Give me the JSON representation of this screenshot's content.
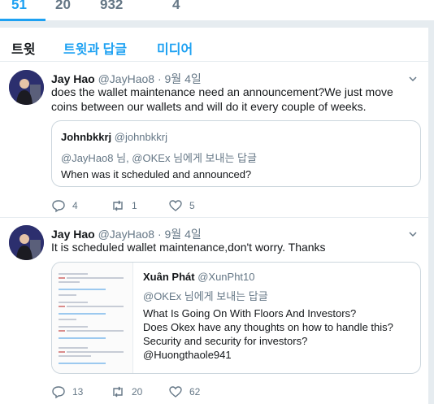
{
  "stats": [
    "51",
    "20",
    "932",
    "4"
  ],
  "tabs": [
    "트윗",
    "트윗과 답글",
    "미디어"
  ],
  "tweets": [
    {
      "name": "Jay Hao",
      "handle": "@JayHao8",
      "dot": "·",
      "date": "9월 4일",
      "text": "does the wallet maintenance need an announcement?We just move coins between our wallets and will do it every couple of weeks.",
      "quote": {
        "name": "Johnbkkrj",
        "handle": "@johnbkkrj",
        "reply_to": "@JayHao8 님, @OKEx 님에게 보내는 답글",
        "text": "When was it scheduled and announced?"
      },
      "replies": "4",
      "retweets": "1",
      "likes": "5"
    },
    {
      "name": "Jay Hao",
      "handle": "@JayHao8",
      "dot": "·",
      "date": "9월 4일",
      "text": "It is scheduled wallet maintenance,don't worry. Thanks",
      "quote": {
        "name": "Xuân Phát",
        "handle": "@XunPht10",
        "reply_to": "@OKEx 님에게 보내는 답글",
        "text_lines": [
          "What Is Going On With Floors And Investors?",
          "Does Okex have any thoughts on how to handle this?",
          "Security and security for investors?",
          "@Huongthaole941"
        ]
      },
      "replies": "13",
      "retweets": "20",
      "likes": "62"
    }
  ],
  "colors": {
    "accent": "#1da1f2",
    "muted": "#657786",
    "border": "#e6ecf0"
  }
}
